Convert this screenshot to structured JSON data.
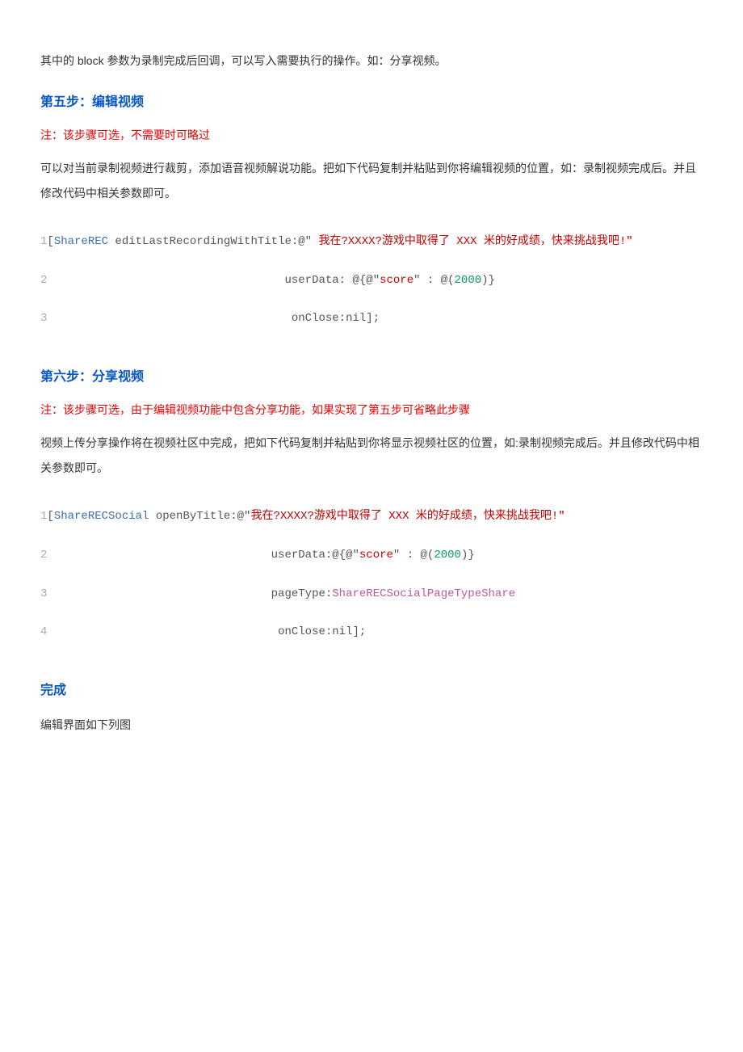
{
  "p_intro": "其中的 block 参数为录制完成后回调，可以写入需要执行的操作。如：分享视频。",
  "step5": {
    "heading": "第五步：编辑视频",
    "note": "注：该步骤可选，不需要时可略过",
    "desc": "可以对当前录制视频进行裁剪，添加语音视频解说功能。把如下代码复制并粘贴到你将编辑视频的位置，如：录制视频完成后。并且修改代码中相关参数即可。",
    "code": {
      "l1": {
        "ln": "1",
        "open": "[",
        "cls": "ShareREC",
        "method": " editLastRecordingWithTitle:",
        "at": "@\"",
        "str": " 我在?XXXX?游戏中取得了 XXX 米的好成绩，快来挑战我吧!\""
      },
      "l2": {
        "ln": "2",
        "pad": "                                   ",
        "label": "userData: ",
        "open2": "@{@\"",
        "score": "score",
        "mid": "\" : @(",
        "num": "2000",
        "end": ")}"
      },
      "l3": {
        "ln": "3",
        "pad": "                                    ",
        "label": "onClose:",
        "nil": "nil",
        "close": "];"
      }
    }
  },
  "step6": {
    "heading": "第六步：分享视频",
    "note": "注：该步骤可选，由于编辑视频功能中包含分享功能，如果实现了第五步可省略此步骤",
    "desc": "视频上传分享操作将在视频社区中完成，把如下代码复制并粘贴到你将显示视频社区的位置，如:录制视频完成后。并且修改代码中相关参数即可。",
    "code": {
      "l1": {
        "ln": "1",
        "open": "[",
        "cls": "ShareRECSocial",
        "method": " openByTitle:",
        "at": "@\"",
        "str": "我在?XXXX?游戏中取得了 XXX 米的好成绩，快来挑战我吧!\""
      },
      "l2": {
        "ln": "2",
        "pad": "                                 ",
        "label": "userData:",
        "open2": "@{@\"",
        "score": "score",
        "mid": "\" : @(",
        "num": "2000",
        "end": ")}"
      },
      "l3": {
        "ln": "3",
        "pad": "                                 ",
        "label": "pageType:",
        "kw": "ShareRECSocialPageTypeShare"
      },
      "l4": {
        "ln": "4",
        "pad": "                                  ",
        "label": "onClose:",
        "nil": "nil",
        "close": "];"
      }
    }
  },
  "done": {
    "heading": "完成",
    "desc": "编辑界面如下列图"
  }
}
